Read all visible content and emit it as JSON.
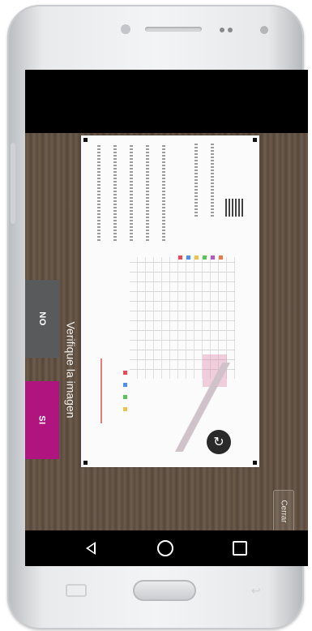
{
  "prompt": {
    "verify_text": "Verifique la imagen",
    "no_label": "NO",
    "si_label": "SI"
  },
  "preview": {
    "close_label": "Cerrar"
  },
  "icons": {
    "refresh": "refresh-icon",
    "nav_back": "triangle-back-icon",
    "nav_home": "circle-home-icon",
    "nav_recent": "square-recent-icon"
  },
  "colors": {
    "si_button": "#b0157f",
    "no_button": "#595a5c",
    "background_wood": "#5d4d40"
  }
}
